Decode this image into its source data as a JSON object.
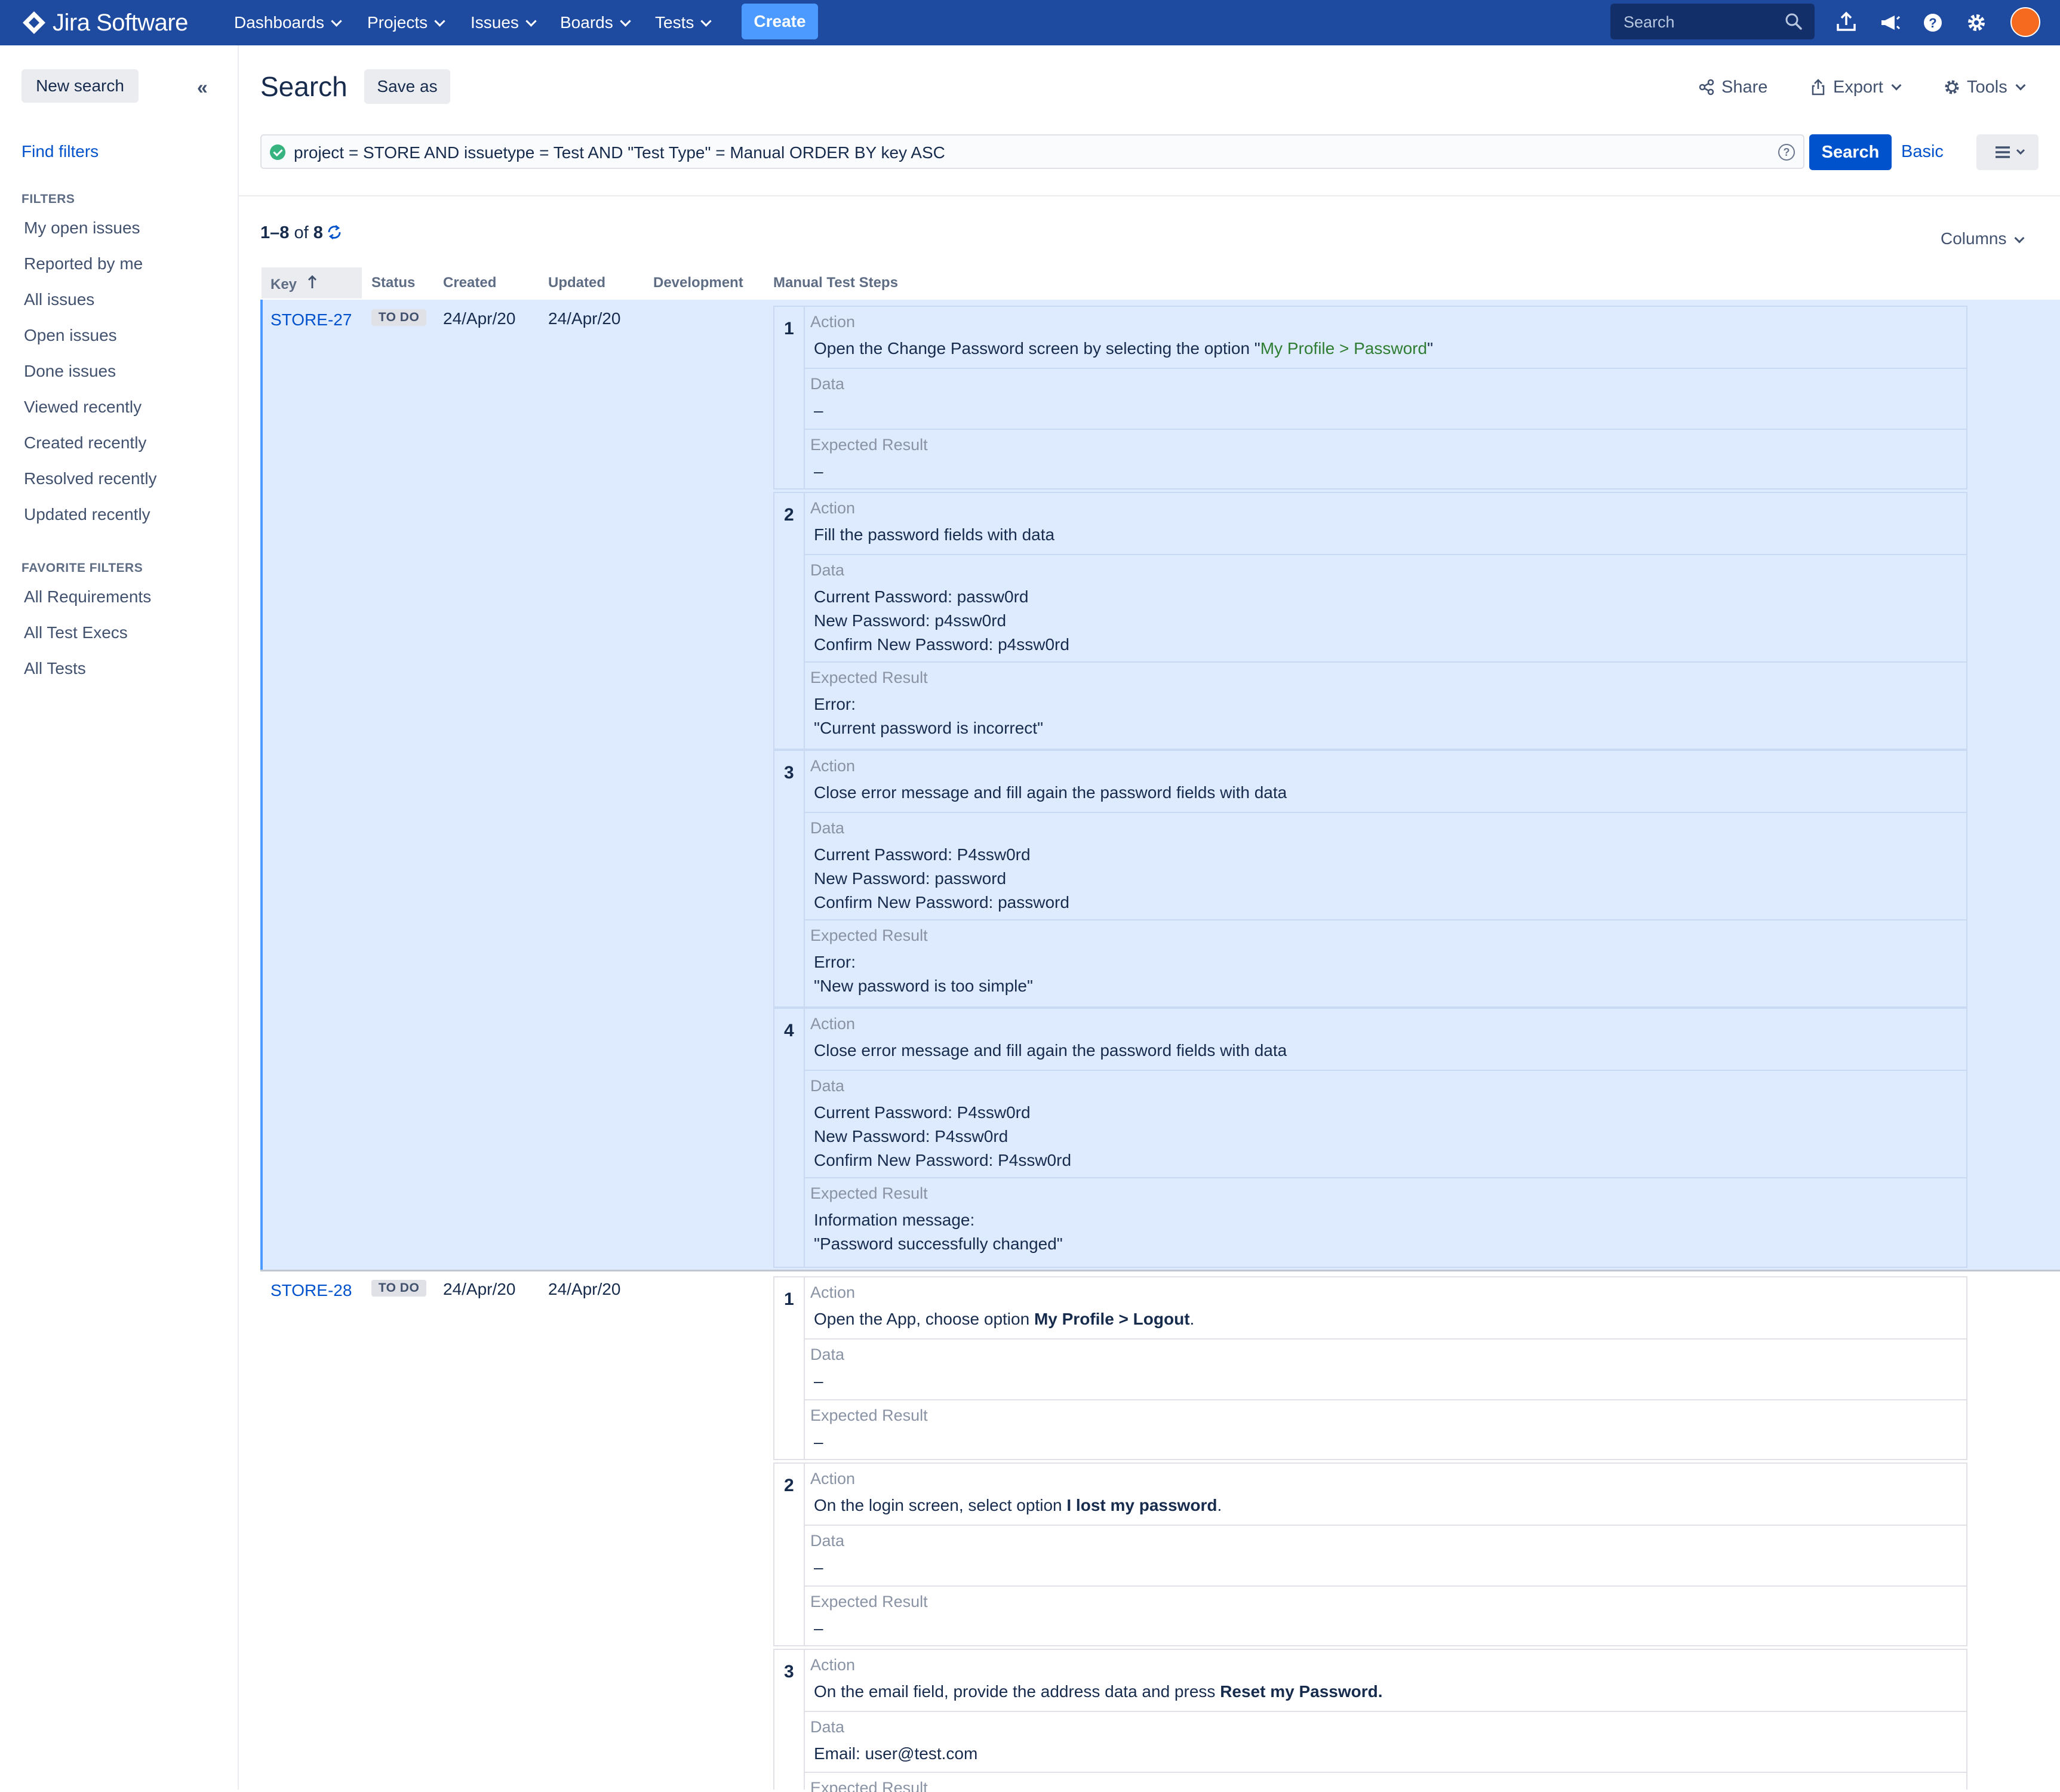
{
  "topnav": {
    "logo": "Jira Software",
    "menu": [
      {
        "label": "Dashboards"
      },
      {
        "label": "Projects"
      },
      {
        "label": "Issues"
      },
      {
        "label": "Boards"
      },
      {
        "label": "Tests"
      }
    ],
    "create_label": "Create",
    "search_placeholder": "Search",
    "icons": [
      "upload-icon",
      "announce-icon",
      "help-icon",
      "settings-icon",
      "avatar"
    ]
  },
  "sidebar": {
    "new_search": "New search",
    "find_filters": "Find filters",
    "filters_heading": "FILTERS",
    "filters": [
      "My open issues",
      "Reported by me",
      "All issues",
      "Open issues",
      "Done issues",
      "Viewed recently",
      "Created recently",
      "Resolved recently",
      "Updated recently"
    ],
    "favorites_heading": "FAVORITE FILTERS",
    "favorites": [
      "All Requirements",
      "All Test Execs",
      "All Tests"
    ]
  },
  "header": {
    "title": "Search",
    "save_as": "Save as",
    "share": "Share",
    "export": "Export",
    "tools": "Tools"
  },
  "query": {
    "jql": "project = STORE AND issuetype = Test AND \"Test Type\" = Manual ORDER BY key ASC",
    "search_button": "Search",
    "basic_link": "Basic"
  },
  "results": {
    "count_range": "1–8",
    "count_of": "of",
    "count_total": "8",
    "columns_label": "Columns",
    "headers": {
      "key": "Key",
      "status": "Status",
      "created": "Created",
      "updated": "Updated",
      "development": "Development",
      "steps": "Manual Test Steps"
    },
    "field_labels": {
      "action": "Action",
      "data": "Data",
      "expected": "Expected Result"
    },
    "rows": [
      {
        "key": "STORE-27",
        "status": "TO DO",
        "created": "24/Apr/20",
        "updated": "24/Apr/20",
        "steps": [
          {
            "num": "1",
            "action_pre": "Open the Change Password screen by selecting the option \"",
            "action_link": "My Profile > Password",
            "action_post": "\"",
            "data": [
              "–"
            ],
            "expected": [
              "–"
            ]
          },
          {
            "num": "2",
            "action": "Fill the password fields with data",
            "data": [
              "Current Password: passw0rd",
              "New Password: p4ssw0rd",
              "Confirm New Password: p4ssw0rd"
            ],
            "expected": [
              "Error:",
              "\"Current password is incorrect\""
            ]
          },
          {
            "num": "3",
            "action": "Close error message and fill again the password fields with data",
            "data": [
              "Current Password: P4ssw0rd",
              "New Password: password",
              "Confirm New Password: password"
            ],
            "expected": [
              "Error:",
              "\"New password is too simple\""
            ]
          },
          {
            "num": "4",
            "action": "Close error message and fill again the password fields with data",
            "data": [
              "Current Password: P4ssw0rd",
              "New Password: P4ssw0rd",
              "Confirm New Password: P4ssw0rd"
            ],
            "expected": [
              "Information message:",
              "\"Password successfully changed\""
            ]
          }
        ]
      },
      {
        "key": "STORE-28",
        "status": "TO DO",
        "created": "24/Apr/20",
        "updated": "24/Apr/20",
        "steps": [
          {
            "num": "1",
            "action_pre": "Open the App, choose option ",
            "action_bold": "My Profile > Logout",
            "action_post": ".",
            "data": [
              "–"
            ],
            "expected": [
              "–"
            ]
          },
          {
            "num": "2",
            "action_pre": "On the login screen, select option ",
            "action_bold": "I lost my password",
            "action_post": ".",
            "data": [
              "–"
            ],
            "expected": [
              "–"
            ]
          },
          {
            "num": "3",
            "action_pre": "On the email field, provide the address data and press ",
            "action_bold": "Reset my Password.",
            "action_post": "",
            "data": [
              "Email: user@test.com"
            ],
            "expected_label_only": true
          }
        ]
      }
    ]
  }
}
